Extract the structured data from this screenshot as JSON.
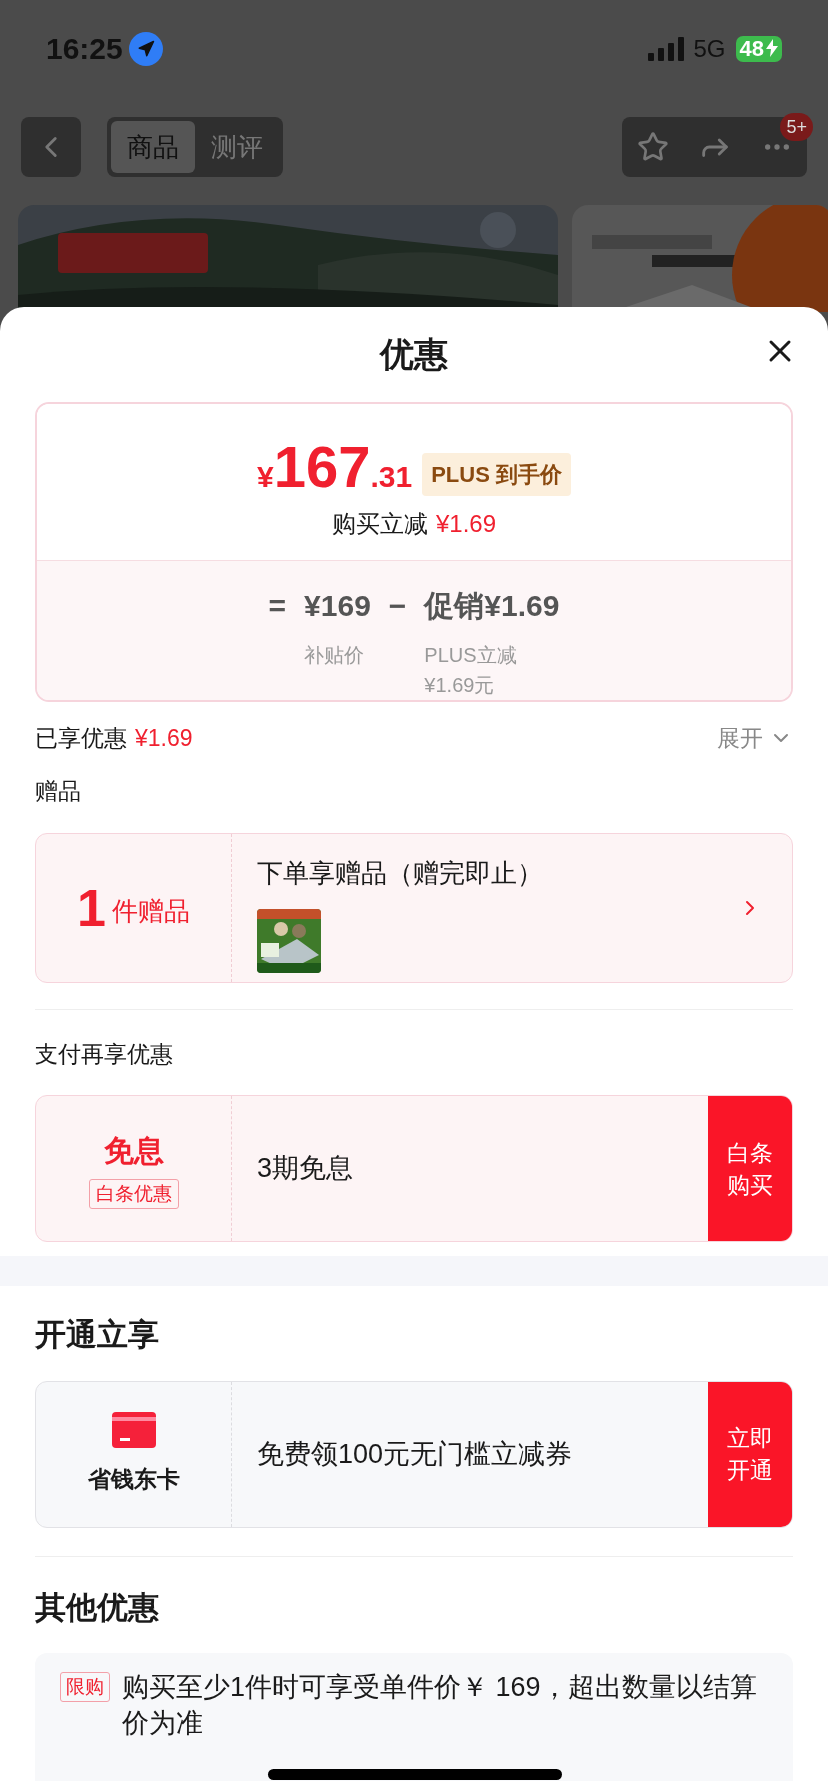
{
  "status_bar": {
    "time": "16:25",
    "network": "5G",
    "battery": "48"
  },
  "nav": {
    "tabs": [
      {
        "label": "商品",
        "selected": true
      },
      {
        "label": "测评",
        "selected": false
      }
    ],
    "badge": "5+"
  },
  "sheet": {
    "title": "优惠"
  },
  "price_card": {
    "currency": "¥",
    "price_int": "167",
    "price_dec": ".31",
    "tag": "PLUS 到手价",
    "reduction_label": "购买立减",
    "reduction_amount": "¥1.69",
    "formula": {
      "equals": "=",
      "base": "¥169",
      "base_label": "补贴价",
      "minus": "−",
      "promo": "促销¥1.69",
      "promo_note": [
        "PLUS立减",
        "¥1.69元"
      ]
    }
  },
  "enjoyed": {
    "label": "已享优惠",
    "amount": "¥1.69",
    "toggle": "展开",
    "expanded": false
  },
  "gift": {
    "title": "赠品",
    "count": "1",
    "unit": "件赠品",
    "text": "下单享赠品（赠完即止）"
  },
  "pay": {
    "title": "支付再享优惠",
    "headline": "免息",
    "tag": "白条优惠",
    "text": "3期免息",
    "button": "白条购买"
  },
  "membership": {
    "title": "开通立享",
    "label": "省钱东卡",
    "text": "免费领100元无门槛立减券",
    "button": "立即开通"
  },
  "other": {
    "title": "其他优惠",
    "items": [
      {
        "tag": "限购",
        "text": "购买至少1件时可享受单件价￥ 169，超出数量以结算价为准"
      }
    ]
  }
}
